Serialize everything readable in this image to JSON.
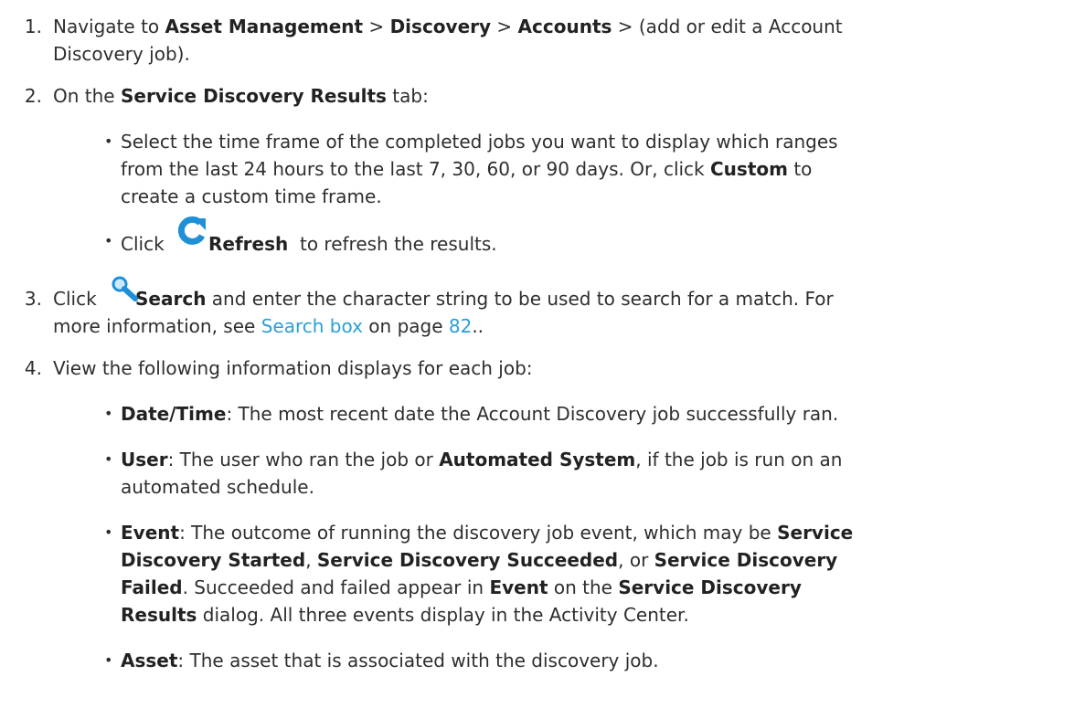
{
  "steps": [
    {
      "number": "1.",
      "lines": {
        "nav_prefix": "Navigate to ",
        "nav_asset": "Asset Management",
        "sep1": " > ",
        "nav_discovery": "Discovery",
        "sep2": " > ",
        "nav_accounts": "Accounts",
        "nav_suffix": " > (add or edit a Account",
        "line2": "Discovery job)."
      }
    },
    {
      "number": "2.",
      "prefix": "On the ",
      "tab_name": "Service Discovery Results",
      "suffix": " tab:",
      "bullets": {
        "timeframe": {
          "line1": "Select the time frame of the completed jobs you want to display which ranges",
          "line2_prefix": "from the last 24 hours to the last 7, 30, 60, or 90 days. Or, click ",
          "line2_bold": "Custom",
          "line2_suffix": " to",
          "line3": "create a custom time frame."
        },
        "refresh": {
          "prefix": "Click ",
          "icon": "refresh-icon",
          "bold": "Refresh",
          "suffix": "  to refresh the results."
        }
      }
    },
    {
      "number": "3.",
      "prefix": "Click ",
      "icon": "search-icon",
      "bold": "Search",
      "line1_suffix": " and enter the character string to be used to search for a match. For",
      "line2_prefix": "more information, see ",
      "link_text": "Search box",
      "line2_mid": " on page ",
      "page_link": "82",
      "line2_suffix": ".."
    },
    {
      "number": "4.",
      "intro": "View the following information displays for each job:",
      "items": {
        "datetime": {
          "term": "Date/Time",
          "desc": ": The most recent date the Account Discovery job successfully ran."
        },
        "user": {
          "term": "User",
          "desc1": ": The user who ran the job or ",
          "bold2": "Automated System",
          "desc2": ", if the job is run on an",
          "line2": "automated schedule."
        },
        "event": {
          "term": "Event",
          "l1_text": ": The outcome of running the discovery job event, which may be ",
          "l1_bold": "Service",
          "l2_bold1": "Discovery Started",
          "l2_sep1": ", ",
          "l2_bold2": "Service Discovery Succeeded",
          "l2_sep2": ", or ",
          "l2_bold3": "Service Discovery",
          "l3_bold1": "Failed",
          "l3_text1": ". Succeeded and failed appear in ",
          "l3_bold2": "Event",
          "l3_text2": " on the ",
          "l3_bold3": "Service Discovery",
          "l4_bold1": "Results",
          "l4_text": " dialog. All three events display in the Activity Center."
        },
        "asset": {
          "term": "Asset",
          "desc": ": The asset that is associated with the discovery job."
        }
      }
    }
  ],
  "colors": {
    "text": "#2e2e2e",
    "link": "#2a9fd6",
    "refresh_icon": "#1e90d8",
    "search_icon": "#1e90d8"
  }
}
